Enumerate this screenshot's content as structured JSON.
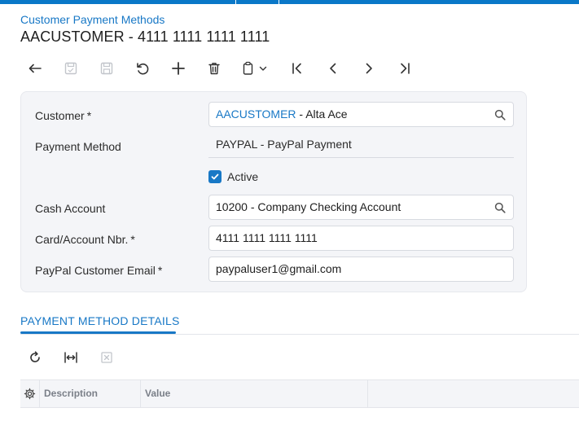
{
  "header": {
    "breadcrumb": "Customer Payment Methods",
    "title": "AACUSTOMER - 4111 1111 1111 1111"
  },
  "toolbar": {
    "buttons": [
      {
        "icon": "undo-back-arrow-icon",
        "enabled": true
      },
      {
        "icon": "save-close-icon",
        "enabled": false
      },
      {
        "icon": "save-icon",
        "enabled": false
      },
      {
        "icon": "cancel-revert-icon",
        "enabled": true
      },
      {
        "icon": "add-icon",
        "enabled": true
      },
      {
        "icon": "delete-icon",
        "enabled": true
      },
      {
        "icon": "copy-paste-icon",
        "enabled": true
      },
      {
        "icon": "first-record-icon",
        "enabled": true
      },
      {
        "icon": "previous-record-icon",
        "enabled": true
      },
      {
        "icon": "next-record-icon",
        "enabled": true
      },
      {
        "icon": "last-record-icon",
        "enabled": true
      }
    ]
  },
  "form": {
    "customer": {
      "label": "Customer",
      "required_mark": "*",
      "value_id": "AACUSTOMER",
      "value_name": " - Alta Ace"
    },
    "payment_method": {
      "label": "Payment Method",
      "value": "PAYPAL - PayPal Payment"
    },
    "active": {
      "label": "Active",
      "checked": true
    },
    "cash_account": {
      "label": "Cash Account",
      "value": "10200 - Company Checking Account"
    },
    "card_account_nbr": {
      "label": "Card/Account Nbr.",
      "required_mark": "*",
      "value": "4111 1111 1111 1111"
    },
    "paypal_email": {
      "label": "PayPal Customer Email",
      "required_mark": "*",
      "value": "paypaluser1@gmail.com"
    }
  },
  "tabs": [
    {
      "label": "PAYMENT METHOD DETAILS",
      "active": true
    }
  ],
  "grid": {
    "toolbar_icons": [
      "refresh-icon",
      "fit-columns-icon",
      "export-excel-icon"
    ],
    "columns": [
      "Description",
      "Value"
    ],
    "rows": []
  },
  "colors": {
    "accent": "#1878c6",
    "top_bar": "#0a78c8",
    "panel_background": "#f4f5f8"
  }
}
